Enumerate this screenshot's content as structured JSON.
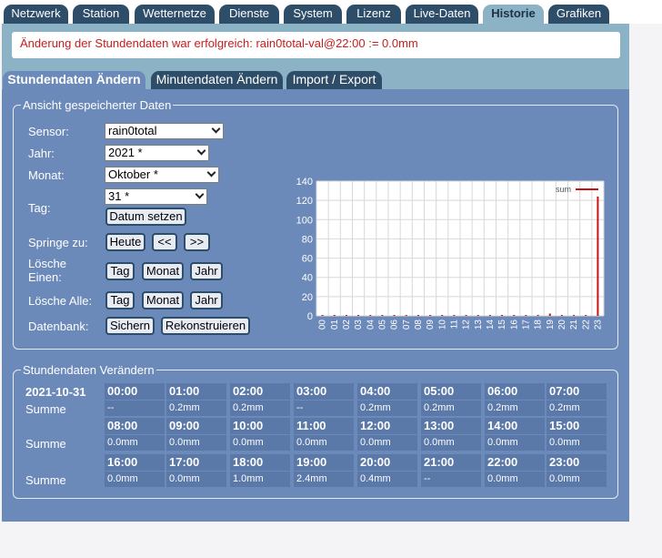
{
  "nav": {
    "tabs": [
      "Netzwerk",
      "Station",
      "Wetternetze",
      "Dienste",
      "System",
      "Lizenz",
      "Live-Daten",
      "Historie",
      "Grafiken"
    ],
    "active": "Historie"
  },
  "message": "Änderung der Stundendaten war erfolgreich: rain0total-val@22:00 := 0.0mm",
  "subtabs": [
    "Stundendaten Ändern",
    "Minutendaten Ändern",
    "Import / Export"
  ],
  "view": {
    "legend": "Ansicht gespeicherter Daten",
    "sensor_label": "Sensor:",
    "sensor_value": "rain0total",
    "jahr_label": "Jahr:",
    "jahr_value": "2021 *",
    "monat_label": "Monat:",
    "monat_value": "Oktober *",
    "tag_label": "Tag:",
    "tag_value": "31 *",
    "datum_setzen": "Datum setzen",
    "springe_label": "Springe zu:",
    "heute": "Heute",
    "prev": "<<",
    "next": ">>",
    "loesche_einen_label_1": "Lösche",
    "loesche_einen_label_2": "Einen:",
    "tag_btn": "Tag",
    "monat_btn": "Monat",
    "jahr_btn": "Jahr",
    "loesche_alle_label": "Lösche Alle:",
    "datenbank_label": "Datenbank:",
    "sichern": "Sichern",
    "rekonstruieren": "Rekonstruieren"
  },
  "chart_data": {
    "type": "bar",
    "categories": [
      "00",
      "01",
      "02",
      "03",
      "04",
      "05",
      "06",
      "07",
      "08",
      "09",
      "10",
      "11",
      "12",
      "13",
      "14",
      "15",
      "16",
      "17",
      "18",
      "19",
      "20",
      "21",
      "22",
      "23"
    ],
    "series": [
      {
        "name": "sum",
        "values": [
          0,
          0.2,
          0.2,
          0,
          0.2,
          0.2,
          0.2,
          0.2,
          0,
          0,
          0,
          0,
          0,
          0,
          0,
          0,
          0,
          0,
          1,
          2.4,
          0.4,
          0,
          0,
          124
        ]
      }
    ],
    "ylim": [
      0,
      140
    ],
    "yticks": [
      0,
      20,
      40,
      60,
      80,
      100,
      120,
      140
    ],
    "grid": true,
    "legend_position": "top-right",
    "colors": {
      "series": "#cc1111",
      "plot_bg": "#ffffff",
      "grid": "#d8d8d8",
      "text": "#ffffff"
    }
  },
  "edit": {
    "legend": "Stundendaten Verändern",
    "date": "2021-10-31",
    "summe_label": "Summe",
    "rows": [
      {
        "hours": [
          "00:00",
          "01:00",
          "02:00",
          "03:00",
          "04:00",
          "05:00",
          "06:00",
          "07:00"
        ],
        "values": [
          "--",
          "0.2mm",
          "0.2mm",
          "--",
          "0.2mm",
          "0.2mm",
          "0.2mm",
          "0.2mm"
        ]
      },
      {
        "hours": [
          "08:00",
          "09:00",
          "10:00",
          "11:00",
          "12:00",
          "13:00",
          "14:00",
          "15:00"
        ],
        "values": [
          "0.0mm",
          "0.0mm",
          "0.0mm",
          "0.0mm",
          "0.0mm",
          "0.0mm",
          "0.0mm",
          "0.0mm"
        ]
      },
      {
        "hours": [
          "16:00",
          "17:00",
          "18:00",
          "19:00",
          "20:00",
          "21:00",
          "22:00",
          "23:00"
        ],
        "values": [
          "0.0mm",
          "0.0mm",
          "1.0mm",
          "2.4mm",
          "0.4mm",
          "--",
          "0.0mm",
          "0.0mm"
        ]
      }
    ]
  }
}
